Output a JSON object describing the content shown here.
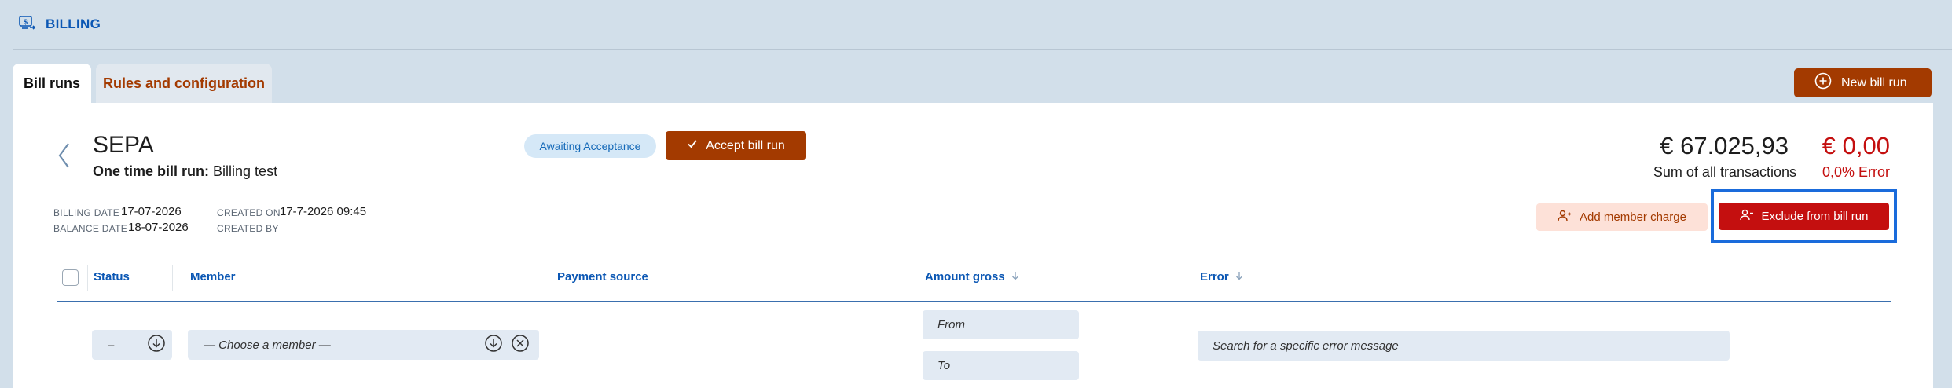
{
  "header": {
    "section_label": "BILLING",
    "icon": "billing-icon"
  },
  "tabs": [
    {
      "label": "Bill runs",
      "active": true
    },
    {
      "label": "Rules and configuration",
      "active": false
    }
  ],
  "toolbar": {
    "new_bill_run_label": "New bill run"
  },
  "bill_run": {
    "title": "SEPA",
    "subtitle_prefix": "One time bill run:",
    "subtitle_value": "Billing test",
    "status_badge": "Awaiting Acceptance",
    "accept_label": "Accept bill run",
    "meta": {
      "billing_date_label": "BILLING DATE",
      "billing_date": "17-07-2026",
      "balance_date_label": "BALANCE DATE",
      "balance_date": "18-07-2026",
      "created_on_label": "CREATED ON",
      "created_on": "17-7-2026 09:45",
      "created_by_label": "CREATED BY",
      "created_by": ""
    }
  },
  "totals": {
    "sum_amount": "€ 67.025,93",
    "sum_label": "Sum of all transactions",
    "error_amount": "€ 0,00",
    "error_label": "0,0% Error"
  },
  "actions": {
    "add_member_charge": "Add member charge",
    "exclude_from_bill_run": "Exclude from bill run"
  },
  "table": {
    "columns": [
      "Status",
      "Member",
      "Payment source",
      "Amount gross",
      "Error"
    ]
  },
  "filters": {
    "status_value": "–",
    "member_placeholder": "— Choose a member —",
    "amount_from_placeholder": "From",
    "amount_to_placeholder": "To",
    "error_placeholder": "Search for a specific error message"
  },
  "colors": {
    "accent_brown": "#a33a00",
    "error_red": "#c40f0f",
    "link_blue": "#0b57b4",
    "highlight_blue": "#1a6bdb"
  }
}
